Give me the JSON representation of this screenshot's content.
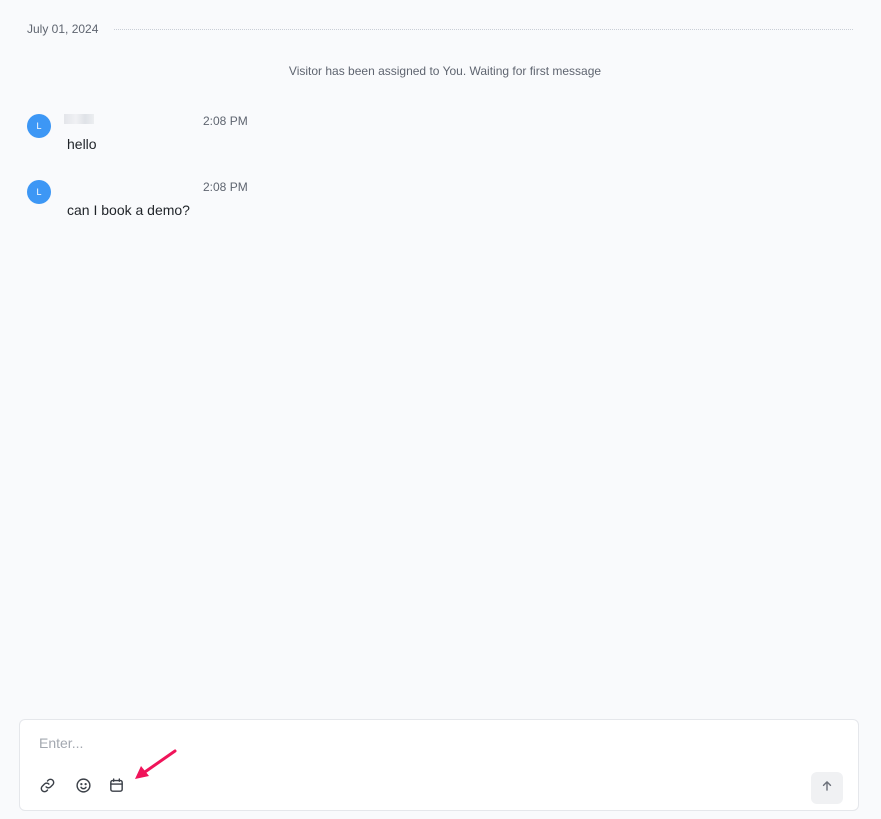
{
  "conversation": {
    "date": "July 01, 2024",
    "system_message": "Visitor has been assigned to You. Waiting for first message",
    "messages": [
      {
        "avatar_initial": "L",
        "sender": "",
        "time": "2:08 PM",
        "text": "hello"
      },
      {
        "avatar_initial": "L",
        "sender": "",
        "time": "2:08 PM",
        "text": "can I book a demo?"
      }
    ]
  },
  "composer": {
    "placeholder": "Enter...",
    "value": "",
    "tools": [
      "link-icon",
      "emoji-icon",
      "calendar-icon"
    ],
    "send_icon": "arrow-up-icon"
  },
  "colors": {
    "background": "#f9fafc",
    "avatar": "#3d97f5",
    "annotation_arrow": "#f0145a"
  }
}
